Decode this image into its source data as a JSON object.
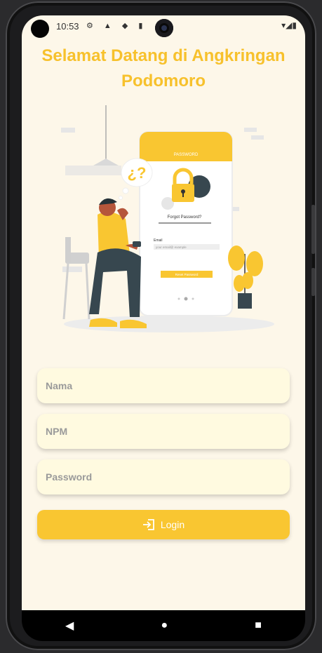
{
  "status_bar": {
    "time": "10:53",
    "left_icons": "⚙ ▲ ◆ ▮",
    "right_icons": "▾◢▮"
  },
  "title": "Selamat Datang di Angkringan Podomoro",
  "illustration": {
    "header_label": "PASSWORD",
    "forgot_label": "Forgot Password?",
    "email_label": "Email",
    "email_placeholder": "your email@ example",
    "reset_label": "Reset Password"
  },
  "form": {
    "nama_placeholder": "Nama",
    "npm_placeholder": "NPM",
    "password_placeholder": "Password"
  },
  "login": {
    "label": "Login",
    "icon": "login-icon"
  },
  "colors": {
    "accent": "#f9c631",
    "title": "#f7c12c",
    "background": "#fdf7e9"
  },
  "nav": {
    "back": "◀",
    "home": "●",
    "recents": "■"
  }
}
